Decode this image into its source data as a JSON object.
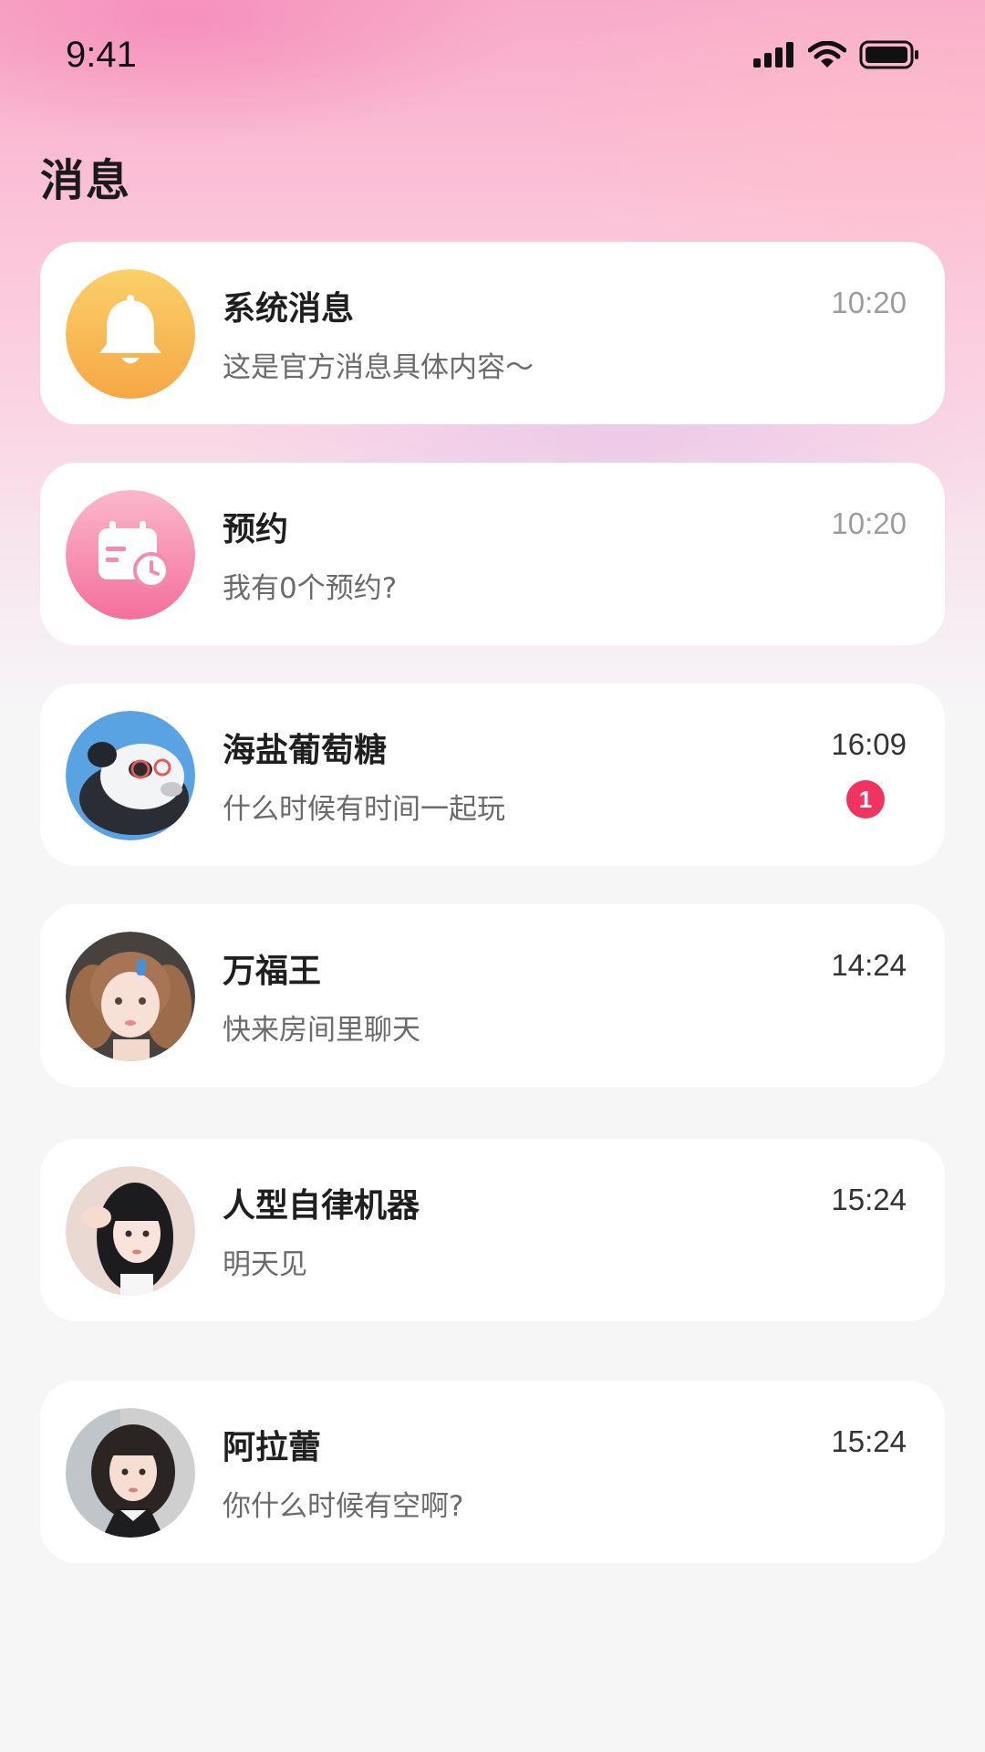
{
  "status_bar": {
    "time": "9:41",
    "icons": [
      "signal-icon",
      "wifi-icon",
      "battery-icon"
    ]
  },
  "header": {
    "title": "消息"
  },
  "conversations": [
    {
      "name": "系统消息",
      "message": "这是官方消息具体内容～",
      "time": "10:20",
      "avatar": "bell-icon",
      "avatar_color": "#f9bd4a"
    },
    {
      "name": "预约",
      "message": "我有0个预约?",
      "time": "10:20",
      "avatar": "calendar-clock-icon",
      "avatar_color": "#f77fa6"
    },
    {
      "name": "海盐葡萄糖",
      "message": "什么时候有时间一起玩",
      "time": "16:09",
      "unread": "1",
      "avatar": "panda-avatar"
    },
    {
      "name": "万福王",
      "message": "快来房间里聊天",
      "time": "14:24",
      "avatar": "user-avatar"
    },
    {
      "name": "人型自律机器",
      "message": "明天见",
      "time": "15:24",
      "avatar": "user-avatar"
    },
    {
      "name": "阿拉蕾",
      "message": "你什么时候有空啊?",
      "time": "15:24",
      "avatar": "user-avatar"
    }
  ],
  "colors": {
    "badge": "#f2325f",
    "header_gradient": "#f8abc9",
    "background": "#f6f6f7"
  }
}
